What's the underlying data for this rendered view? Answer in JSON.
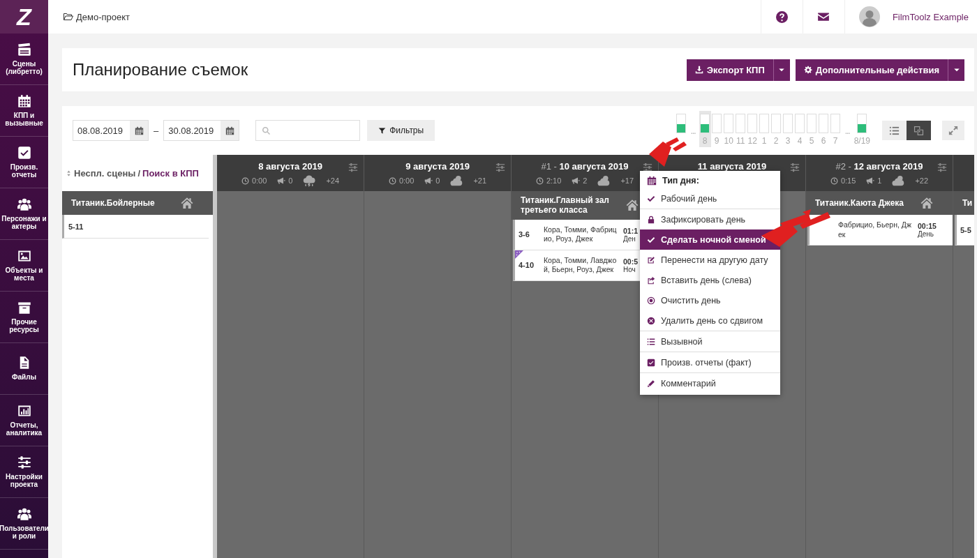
{
  "sidebar": {
    "logo": "Z",
    "items": [
      {
        "label": "Сцены (либретто)"
      },
      {
        "label": "КПП и вызывные"
      },
      {
        "label": "Произв. отчеты"
      },
      {
        "label": "Персонажи и актеры"
      },
      {
        "label": "Объекты и места"
      },
      {
        "label": "Прочие ресурсы"
      },
      {
        "label": "Файлы"
      },
      {
        "label": "Отчеты, аналитика"
      },
      {
        "label": "Настройки проекта"
      },
      {
        "label": "Пользователи и роли"
      }
    ]
  },
  "breadcrumb": "Демо-проект",
  "user": {
    "name": "FilmToolz Example"
  },
  "page": {
    "title": "Планирование съемок",
    "actions": [
      {
        "label": "Экспорт КПП"
      },
      {
        "label": "Дополнительные действия"
      }
    ]
  },
  "filters": {
    "date_from": "08.08.2019",
    "dash": "–",
    "date_to": "30.08.2019",
    "filter_button": "Фильтры"
  },
  "timeline": [
    {
      "kind": "bar",
      "level": 0.45,
      "selected": false
    },
    {
      "kind": "ellipsis",
      "label": "..."
    },
    {
      "kind": "bar",
      "label": "8",
      "level": 0.45,
      "selected": true
    },
    {
      "kind": "bar",
      "label": "9",
      "level": 0,
      "selected": false
    },
    {
      "kind": "bar",
      "label": "10",
      "level": 0,
      "selected": false
    },
    {
      "kind": "bar",
      "label": "11",
      "level": 0,
      "selected": false
    },
    {
      "kind": "bar",
      "label": "12",
      "level": 0,
      "selected": false
    },
    {
      "kind": "bar",
      "label": "1",
      "level": 0,
      "selected": false
    },
    {
      "kind": "bar",
      "label": "2",
      "level": 0,
      "selected": false
    },
    {
      "kind": "bar",
      "label": "3",
      "level": 0,
      "selected": false
    },
    {
      "kind": "bar",
      "label": "4",
      "level": 0,
      "selected": false
    },
    {
      "kind": "bar",
      "label": "5",
      "level": 0,
      "selected": false
    },
    {
      "kind": "bar",
      "label": "6",
      "level": 0,
      "selected": false
    },
    {
      "kind": "bar",
      "label": "7",
      "level": 0,
      "selected": false
    },
    {
      "kind": "ellipsis",
      "label": "..."
    },
    {
      "kind": "bar",
      "label": "8/19",
      "level": 0.45,
      "selected": false
    }
  ],
  "view_modes": [
    {
      "selected": false
    },
    {
      "selected": true
    }
  ],
  "unplanned": {
    "title": "Неспл. сцены",
    "separator": "/",
    "link": "Поиск в КПП",
    "groups": [
      {
        "location": "Титаник.Бойлерные",
        "scenes": [
          "5-11"
        ]
      }
    ]
  },
  "days": [
    {
      "date": "8 августа 2019",
      "time": "0:00",
      "calls": "0",
      "weather": {
        "kind": "storm",
        "temp": "+24"
      }
    },
    {
      "date": "9 августа 2019",
      "time": "0:00",
      "calls": "0",
      "weather": {
        "kind": "cloudy",
        "temp": "+21"
      }
    },
    {
      "number": "#1 -",
      "date": "10 августа 2019",
      "time": "2:10",
      "calls": "2",
      "weather": {
        "kind": "cloudy",
        "temp": "+17"
      },
      "locations": [
        {
          "name": "Титаник.Главный зал третьего класса",
          "scenes": [
            {
              "scene": "3-6",
              "cast": "Кора, Томми, Фабрицио, Роуз, Джек",
              "time": "01:1",
              "shift": "Ден",
              "marked": false
            },
            {
              "scene": "4-10",
              "cast": "Кора, Томми, Лавджой, Бьерн, Роуз, Джек",
              "time": "00:5",
              "shift": "Ноч",
              "marked": true
            }
          ]
        }
      ]
    },
    {
      "date": "11 августа 2019"
    },
    {
      "number": "#2 -",
      "date": "12 августа 2019",
      "time": "0:15",
      "calls": "1",
      "weather": {
        "kind": "cloudy",
        "temp": "+22"
      },
      "locations": [
        {
          "name": "Титаник.Каюта Джека",
          "scenes": [
            {
              "cast": "Фабрицио, Бьерн, Джек",
              "time": "00:15",
              "shift": "День",
              "marked": false
            }
          ]
        }
      ]
    },
    {
      "locations": [
        {
          "name": "Ти",
          "scenes": [
            {
              "scene": "5-5",
              "marked": false
            }
          ]
        }
      ]
    }
  ],
  "menu": {
    "header": "Тип дня:",
    "groups": [
      [
        {
          "label": "Рабочий день",
          "selected": false
        }
      ],
      [
        {
          "label": "Зафиксировать день",
          "selected": false
        },
        {
          "label": "Сделать ночной сменой",
          "selected": true
        },
        {
          "label": "Перенести на другую дату",
          "selected": false
        },
        {
          "label": "Вставить день (слева)",
          "selected": false
        },
        {
          "label": "Очистить день",
          "selected": false
        },
        {
          "label": "Удалить день со сдвигом",
          "selected": false
        }
      ],
      [
        {
          "label": "Вызывной",
          "selected": false
        }
      ],
      [
        {
          "label": "Произв. отчеты (факт)",
          "selected": false
        }
      ],
      [
        {
          "label": "Комментарий",
          "selected": false
        }
      ]
    ]
  }
}
